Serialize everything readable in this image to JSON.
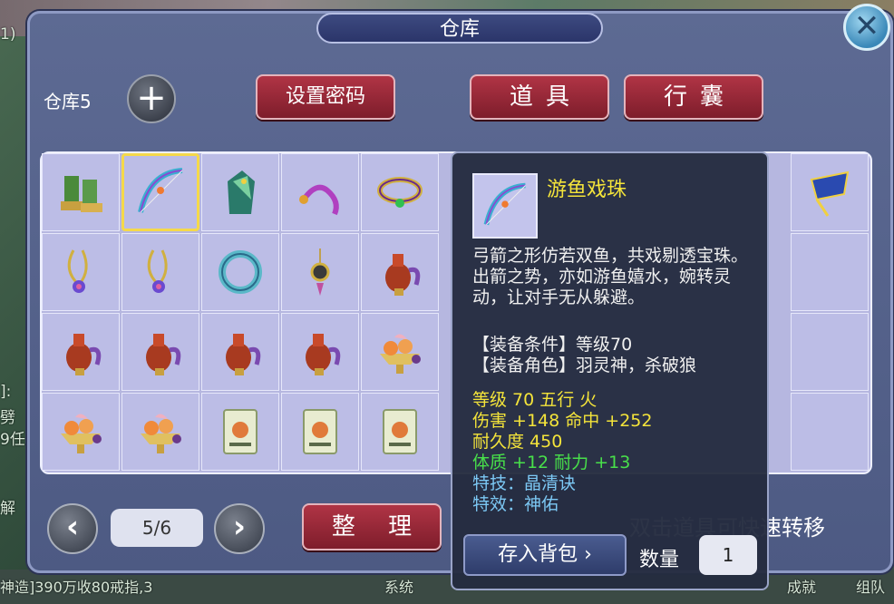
{
  "window": {
    "title": "仓库"
  },
  "warehouse": {
    "label": "仓库5",
    "add_symbol": "+"
  },
  "buttons": {
    "set_password": "设置密码",
    "sort": "整 理"
  },
  "tabs": [
    {
      "label": "道具"
    },
    {
      "label": "行囊"
    }
  ],
  "pager": {
    "page": "5/6",
    "prev": "‹",
    "next": "›"
  },
  "hint": "双击道具可快速转移",
  "close": "✕",
  "background_text": {
    "left1": "1)",
    "left2": "]:",
    "left3": "劈",
    "left4": "9任",
    "left5": "解",
    "bottom1": "神造]390万收80戒指,3",
    "bottom2": "系统",
    "bottom3": "成就",
    "bottom4": "组队"
  },
  "items": [
    {
      "icon": "boots-icon"
    },
    {
      "icon": "bow-icon",
      "selected": true
    },
    {
      "icon": "dragon-armor-icon"
    },
    {
      "icon": "whip-icon"
    },
    {
      "icon": "ring-icon"
    },
    {
      "icon": "necklace-icon"
    },
    {
      "icon": "necklace-icon"
    },
    {
      "icon": "jade-bracelet-icon"
    },
    {
      "icon": "pendant-icon"
    },
    {
      "icon": "gourd-icon"
    },
    {
      "icon": "gourd-icon"
    },
    {
      "icon": "gourd-icon"
    },
    {
      "icon": "gourd-icon"
    },
    {
      "icon": "gourd-icon"
    },
    {
      "icon": "fruit-bowl-icon"
    },
    {
      "icon": "fruit-bowl-icon"
    },
    {
      "icon": "fruit-bowl-icon"
    },
    {
      "icon": "card-icon"
    },
    {
      "icon": "card-icon"
    },
    {
      "icon": "card-icon"
    }
  ],
  "right_items": [
    {
      "icon": "fan-icon"
    }
  ],
  "tooltip": {
    "name": "游鱼戏珠",
    "description": "弓箭之形仿若双鱼，共戏剔透宝珠。出箭之势，亦如游鱼嬉水，婉转灵动，让对手无从躲避。",
    "req_level": "【装备条件】等级70",
    "req_role": "【装备角色】羽灵神，杀破狼",
    "stat_level": "等级 70  五行 火",
    "stat_damage": "伤害 +148 命中 +252",
    "stat_durability": "耐久度 450",
    "stat_bonus": "体质 +12 耐力 +13",
    "special_skill": "特技：晶清诀",
    "special_effect": "特效：神佑",
    "store_button": "存入背包",
    "quantity_label": "数量",
    "quantity": "1"
  }
}
